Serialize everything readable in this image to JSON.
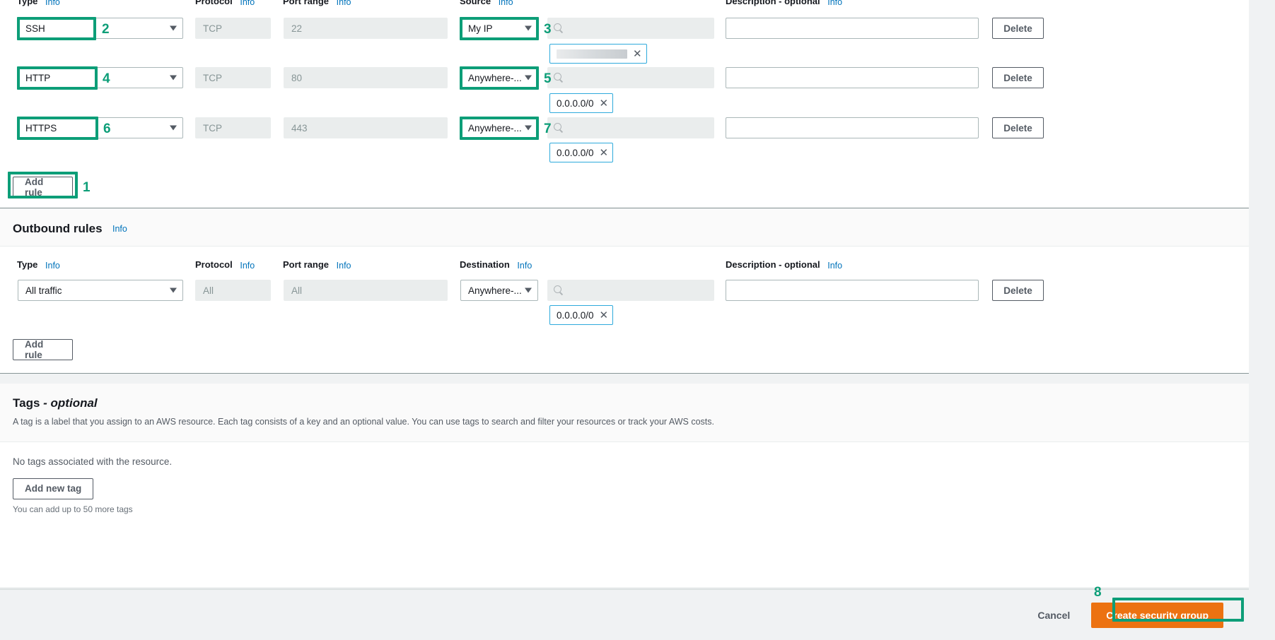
{
  "inbound": {
    "columns": [
      {
        "label": "Type",
        "info": "Info"
      },
      {
        "label": "Protocol",
        "info": "Info"
      },
      {
        "label": "Port range",
        "info": "Info"
      },
      {
        "label": "Source",
        "info": "Info"
      },
      {
        "label": "Description - optional",
        "info": "Info"
      }
    ],
    "rows": [
      {
        "type": "SSH",
        "protocol": "TCP",
        "port": "22",
        "source_type": "My IP",
        "source_placeholder": "",
        "chip": "",
        "chip_redacted": true,
        "description": "",
        "delete_label": "Delete"
      },
      {
        "type": "HTTP",
        "protocol": "TCP",
        "port": "80",
        "source_type": "Anywhere-...",
        "source_placeholder": "",
        "chip": "0.0.0.0/0",
        "chip_redacted": false,
        "description": "",
        "delete_label": "Delete"
      },
      {
        "type": "HTTPS",
        "protocol": "TCP",
        "port": "443",
        "source_type": "Anywhere-...",
        "source_placeholder": "",
        "chip": "0.0.0.0/0",
        "chip_redacted": false,
        "description": "",
        "delete_label": "Delete"
      }
    ],
    "add_rule_label": "Add rule"
  },
  "outbound": {
    "title": "Outbound rules",
    "info": "Info",
    "columns": [
      {
        "label": "Type",
        "info": "Info"
      },
      {
        "label": "Protocol",
        "info": "Info"
      },
      {
        "label": "Port range",
        "info": "Info"
      },
      {
        "label": "Destination",
        "info": "Info"
      },
      {
        "label": "Description - optional",
        "info": "Info"
      }
    ],
    "rows": [
      {
        "type": "All traffic",
        "protocol": "All",
        "port": "All",
        "destination_type": "Anywhere-...",
        "chip": "0.0.0.0/0",
        "description": "",
        "delete_label": "Delete"
      }
    ],
    "add_rule_label": "Add rule"
  },
  "tags": {
    "title": "Tags",
    "title_optional": "- optional",
    "description": "A tag is a label that you assign to an AWS resource. Each tag consists of a key and an optional value. You can use tags to search and filter your resources or track your AWS costs.",
    "empty_text": "No tags associated with the resource.",
    "add_tag_label": "Add new tag",
    "limit_note": "You can add up to 50 more tags"
  },
  "footer": {
    "cancel_label": "Cancel",
    "create_label": "Create security group"
  },
  "annotations": {
    "n1": "1",
    "n2": "2",
    "n3": "3",
    "n4": "4",
    "n5": "5",
    "n6": "6",
    "n7": "7",
    "n8": "8"
  },
  "colors": {
    "annotation_green": "#0d9e78",
    "primary_orange": "#ec7211",
    "link_blue": "#0073bb",
    "chip_border": "#2eaadc"
  }
}
